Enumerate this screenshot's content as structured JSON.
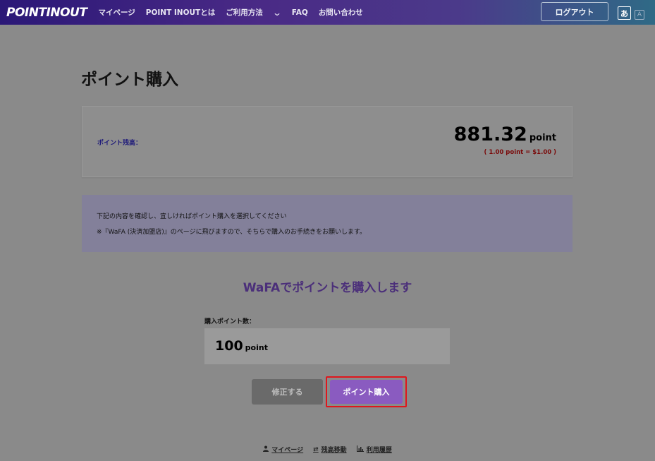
{
  "header": {
    "logo": "POINTINOUT",
    "nav": [
      "マイページ",
      "POINT INOUTとは",
      "ご利用方法",
      "FAQ",
      "お問い合わせ"
    ],
    "logout": "ログアウト",
    "lang_ja": "あ",
    "lang_en": "A"
  },
  "page": {
    "title": "ポイント購入"
  },
  "balance": {
    "label": "ポイント残高：",
    "value": "881.32",
    "unit": "point",
    "rate": "( 1.00 point = $1.00 )"
  },
  "notice": {
    "line1": "下記の内容を確認し、宜しければポイント購入を選択してください",
    "line2": "※『WaFA (決済加盟店)』のページに飛びますので、そちらで購入のお手続きをお願いします。"
  },
  "purchase": {
    "heading": "WaFAでポイントを購入します",
    "qty_label": "購入ポイント数：",
    "qty_value": "100",
    "qty_unit": "point"
  },
  "buttons": {
    "edit": "修正する",
    "buy": "ポイント購入"
  },
  "footer": {
    "mypage": "マイページ",
    "transfer": "残高移動",
    "history": "利用履歴"
  }
}
